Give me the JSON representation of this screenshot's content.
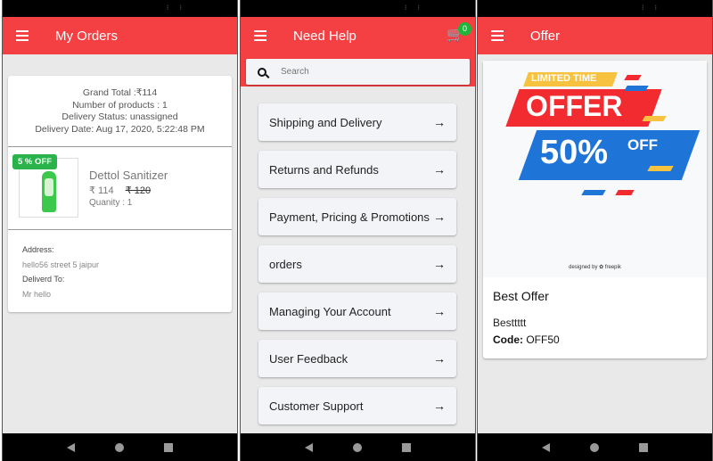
{
  "screens": {
    "orders": {
      "title": "My Orders",
      "summary": {
        "grand_total": "Grand Total :₹114",
        "num_products": "Number of products : 1",
        "delivery_status": "Delivery Status: unassigned",
        "delivery_date": "Delivery Date: Aug 17, 2020, 5:22:48 PM"
      },
      "product": {
        "badge": "5 % OFF",
        "name": "Dettol Sanitizer",
        "price": "₹ 114",
        "old_price": "₹ 120",
        "quantity": "Quanity : 1"
      },
      "address": {
        "address_label": "Address:",
        "address_value": "hello56 street 5 jaipur",
        "delivered_label": "Deliverd To:",
        "delivered_value": "Mr hello"
      }
    },
    "help": {
      "title": "Need Help",
      "cart_count": "0",
      "search_placeholder": "Search",
      "items": [
        {
          "label": "Shipping and Delivery"
        },
        {
          "label": "Returns and Refunds"
        },
        {
          "label": "Payment, Pricing & Promotions"
        },
        {
          "label": "orders"
        },
        {
          "label": "Managing Your Account"
        },
        {
          "label": "User Feedback"
        },
        {
          "label": "Customer Support"
        }
      ],
      "arrow": "→"
    },
    "offer": {
      "title": "Offer",
      "banner": {
        "limited": "LIMITED TIME",
        "offer": "OFFER",
        "percent": "50%",
        "off": "OFF",
        "credit": "designed by ✿ freepik"
      },
      "card_title": "Best Offer",
      "description": "Besttttt",
      "code_label": "Code:",
      "code_value": "OFF50"
    }
  },
  "colors": {
    "appbar": "#f44043",
    "badge_green": "#2ab34a",
    "banner_red": "#f12b2f",
    "banner_blue": "#1f74d8",
    "banner_yellow": "#f7c23f"
  }
}
